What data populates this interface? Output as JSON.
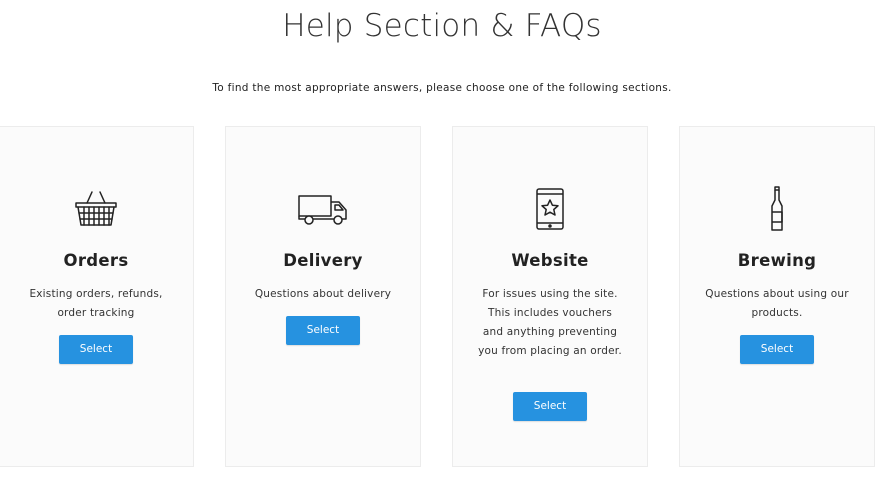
{
  "page": {
    "title": "Help Section & FAQs",
    "subtitle": "To find the most appropriate answers, please choose one of the following sections."
  },
  "cards": [
    {
      "icon": "basket-icon",
      "title": "Orders",
      "description": "Existing orders, refunds, order tracking",
      "button_label": "Select"
    },
    {
      "icon": "truck-icon",
      "title": "Delivery",
      "description": "Questions about delivery",
      "button_label": "Select"
    },
    {
      "icon": "mobile-star-icon",
      "title": "Website",
      "description": "For issues using the site. This includes vouchers and anything preventing you from placing an order.",
      "button_label": "Select"
    },
    {
      "icon": "bottle-icon",
      "title": "Brewing",
      "description": "Questions about using our products.",
      "button_label": "Select"
    }
  ],
  "colors": {
    "button": "#2692e0",
    "card_background": "#fbfbfb",
    "card_border": "#ececec"
  }
}
